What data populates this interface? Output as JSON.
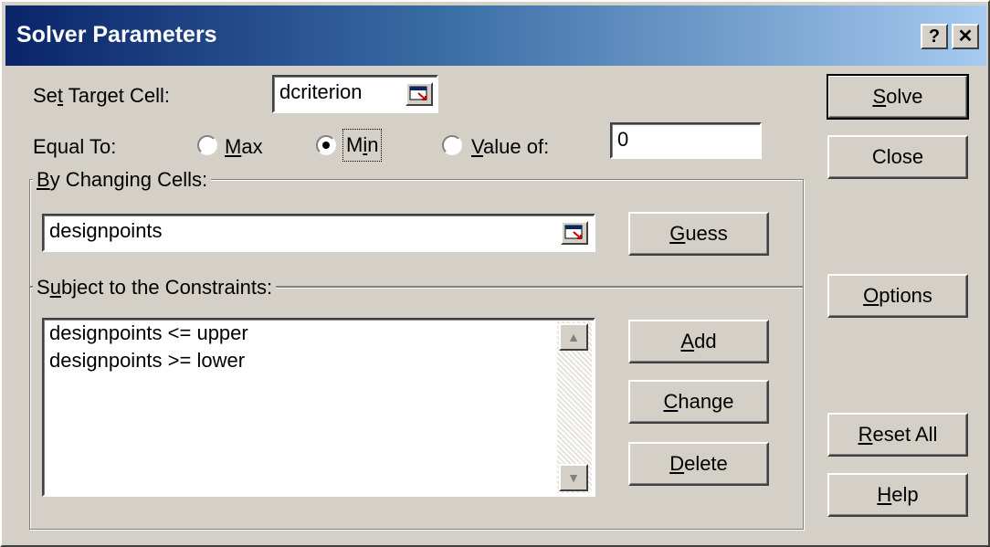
{
  "dialog": {
    "title": "Solver Parameters",
    "help_btn": "?",
    "close_btn": "✕"
  },
  "target": {
    "label_pre": "Se",
    "label_ul": "t",
    "label_post": " Target Cell:",
    "value": "dcriterion"
  },
  "equal_to": {
    "label": "Equal To:",
    "options": {
      "max": {
        "pre": "",
        "ul": "M",
        "post": "ax"
      },
      "min": {
        "pre": "M",
        "ul": "i",
        "post": "n"
      },
      "value_of": {
        "pre": "",
        "ul": "V",
        "post": "alue of:"
      }
    },
    "selected": "min",
    "value": "0"
  },
  "changing": {
    "label_pre": "",
    "label_ul": "B",
    "label_post": "y Changing Cells:",
    "value": "designpoints",
    "guess": {
      "pre": "",
      "ul": "G",
      "post": "uess"
    }
  },
  "constraints": {
    "label_pre": "S",
    "label_ul": "u",
    "label_post": "bject to the Constraints:",
    "items": [
      "designpoints <= upper",
      "designpoints >= lower"
    ],
    "add": {
      "pre": "",
      "ul": "A",
      "post": "dd"
    },
    "change": {
      "pre": "",
      "ul": "C",
      "post": "hange"
    },
    "delete": {
      "pre": "",
      "ul": "D",
      "post": "elete"
    }
  },
  "side": {
    "solve": {
      "pre": "",
      "ul": "S",
      "post": "olve"
    },
    "close": "Close",
    "options": {
      "pre": "",
      "ul": "O",
      "post": "ptions"
    },
    "reset": {
      "pre": "",
      "ul": "R",
      "post": "eset All"
    },
    "help": {
      "pre": "",
      "ul": "H",
      "post": "elp"
    }
  }
}
